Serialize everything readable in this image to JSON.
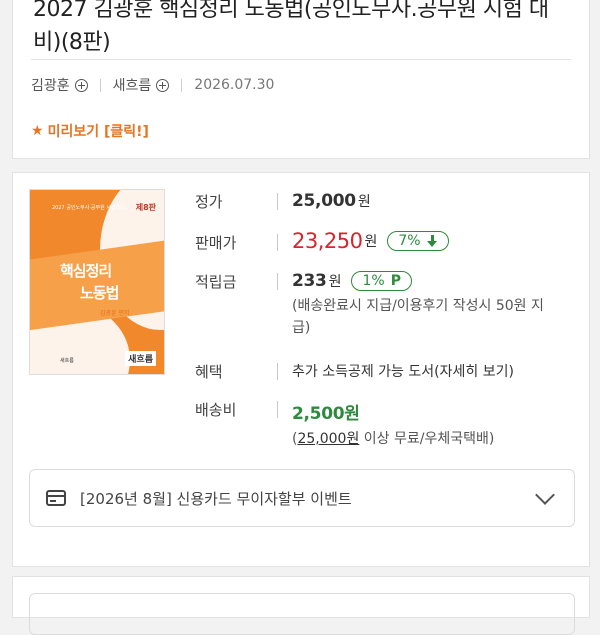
{
  "product": {
    "title": "2027 김광훈 핵심정리 노동법(공인노무사.공무원 시험 대비)(8판)",
    "author": "김광훈",
    "publisher": "새흐름",
    "date": "2026.07.30",
    "preview_label": "미리보기 [클릭!]"
  },
  "cover": {
    "top_text": "2027 공인노무사·공무원 시험대비",
    "edition": "제8판",
    "title_line1": "핵심정리",
    "title_line2": "노동법",
    "author": "김광훈 편저",
    "publisher": "새흐름",
    "publisher_small": "새흐름"
  },
  "price": {
    "list_label": "정가",
    "list_value": "25,000",
    "won": "원",
    "sale_label": "판매가",
    "sale_value": "23,250",
    "discount": "7%",
    "points_label": "적립금",
    "points_value": "233",
    "points_rate": "1%",
    "points_badge": "P",
    "points_note": "(배송완료시 지급/이용후기 작성시 50원 지급)",
    "benefit_label": "혜택",
    "benefit_text": "추가 소득공제 가능 도서(자세히 보기)",
    "shipping_label": "배송비",
    "shipping_value": "2,500원",
    "shipping_note_open": "(",
    "shipping_note_amount": "25,000원",
    "shipping_note_rest": " 이상 무료/우체국택배)"
  },
  "promo": {
    "text": "[2026년 8월] 신용카드 무이자할부 이벤트"
  },
  "colors": {
    "accent_orange": "#e8741f",
    "sale_red": "#d9232d",
    "discount_green": "#2e8b3e"
  }
}
